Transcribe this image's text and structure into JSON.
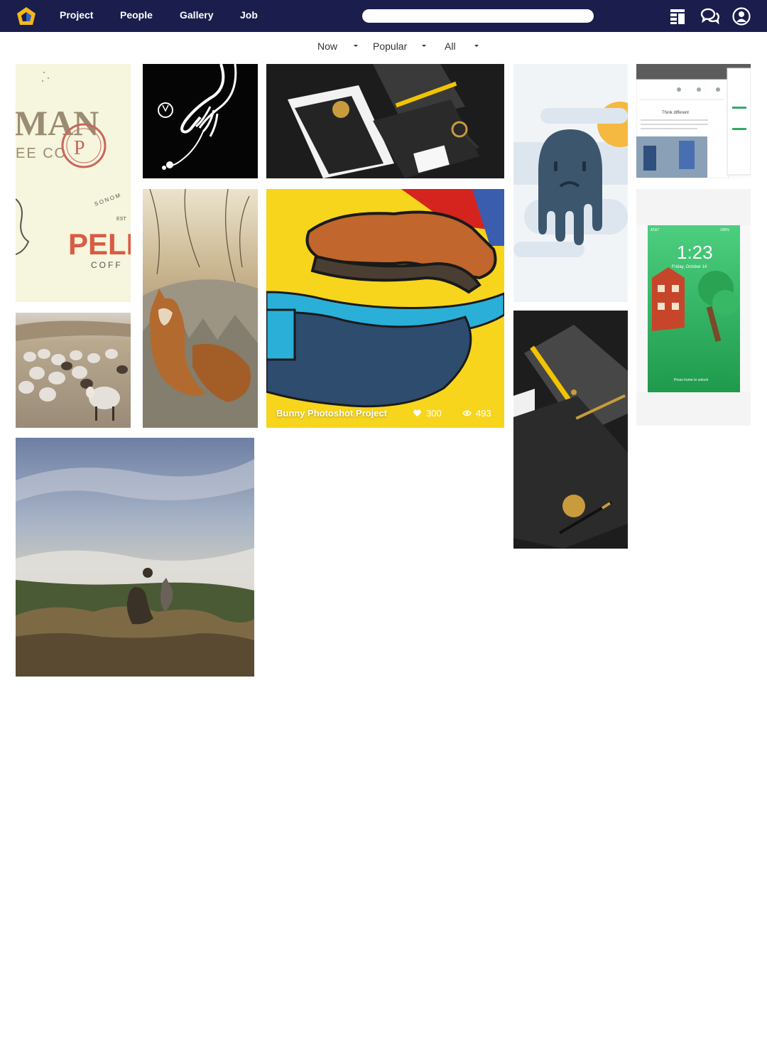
{
  "nav": {
    "links": [
      "Project",
      "People",
      "Gallery",
      "Job"
    ],
    "search_placeholder": ""
  },
  "filters": [
    {
      "label": "Now"
    },
    {
      "label": "Popular"
    },
    {
      "label": "All"
    }
  ],
  "featured": {
    "title": "Bunny Photoshot Project",
    "likes": "300",
    "views": "493"
  },
  "tiles": [
    {
      "name": "coffee-brand-tile",
      "text_big": "MAN",
      "text_sub": "EE CO",
      "text_brand": "PELI",
      "text_coff": "COFF",
      "text_sonoma": "SONOM",
      "text_est": "EST"
    },
    {
      "name": "hand-illustration-tile"
    },
    {
      "name": "stationery-mockup-tile"
    },
    {
      "name": "ghost-illustration-tile"
    },
    {
      "name": "website-screenshot-tile",
      "text_heading": "Think different"
    },
    {
      "name": "sheep-herd-tile"
    },
    {
      "name": "fox-photo-tile"
    },
    {
      "name": "shoe-illustration-tile"
    },
    {
      "name": "notebook-mockup-tile"
    },
    {
      "name": "phone-lockscreen-tile",
      "time": "1:23",
      "date": "Friday, October 14",
      "carrier": "AT&T",
      "battery": "100%",
      "unlock": "Press home to unlock"
    },
    {
      "name": "mountain-photo-tile"
    }
  ],
  "colors": {
    "nav_bg": "#1b1d4d",
    "logo_yellow": "#f2b91a",
    "logo_blue": "#3560c9"
  }
}
